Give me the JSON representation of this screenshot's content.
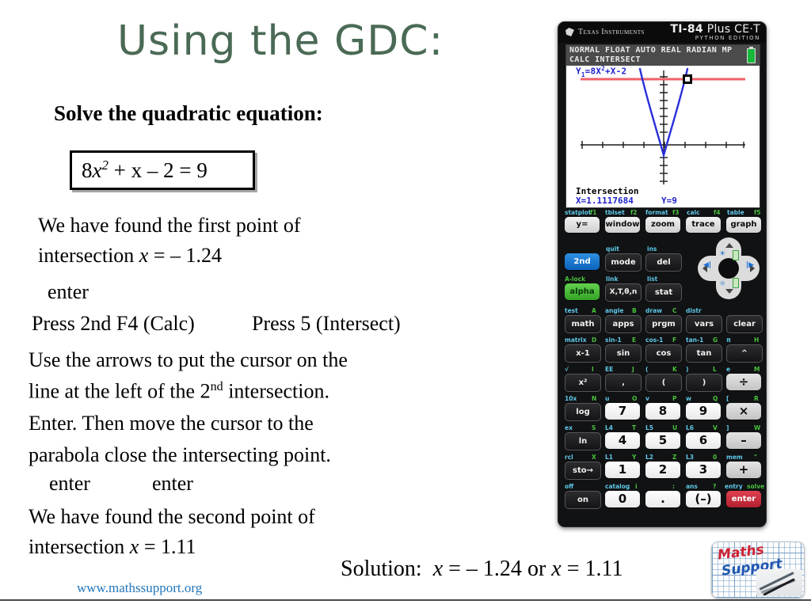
{
  "title": "Using the GDC:",
  "title_color": "#4a6a55",
  "solve_heading": "Solve the quadratic equation:",
  "equation": {
    "coef": "8",
    "var": "x",
    "power": "2",
    "rest": " + x – 2 = 9"
  },
  "body": {
    "found_first_l1": "We have found the first point of",
    "found_first_l2_pre": "intersection ",
    "found_first_l2_var": "x",
    "found_first_l2_post": " = – 1.24",
    "enter_1": "enter",
    "press_calc": "Press 2nd F4 (Calc)",
    "press_intersect": "Press 5 (Intersect)",
    "use_l1": "Use the arrows to put the cursor on the",
    "use_l2_pre": "line at the left of the 2",
    "use_l2_sup": "nd",
    "use_l2_post": "  intersection.",
    "use_l3": "Enter. Then move the cursor to the",
    "use_l4": "parabola close the intersecting point.",
    "enter_2a": "enter",
    "enter_2b": "enter",
    "found_second_l1": "We have found the second point of",
    "found_second_l2_pre": "intersection ",
    "found_second_l2_var": "x",
    "found_second_l2_post": " = 1.11"
  },
  "solution": {
    "label": "Solution:",
    "first_var": "x",
    "first_val": " = – 1.24",
    "conj": "  or  ",
    "second_var": "x",
    "second_val": " = 1.11"
  },
  "footer": {
    "url": "www.mathssupport.org",
    "url_color": "#2277bb"
  },
  "logo": {
    "word_top": "Maths",
    "word_bottom": "Support"
  },
  "calculator": {
    "brand": "Texas Instruments",
    "model_line1_bold": "TI-84",
    "model_line1_rest": " Plus CE·T",
    "model_line2": "PYTHON EDITION",
    "screen": {
      "status_line1": "NORMAL FLOAT AUTO REAL RADIAN MP",
      "status_line2": "CALC INTERSECT",
      "function_prefix": "Y",
      "function_sub": "1",
      "function_body": "=8X",
      "function_sup": "2",
      "function_tail": "+X-2",
      "readout_label": "Intersection",
      "readout_x": "X=1.1117684",
      "readout_y": "Y=9",
      "curve_color": "#2a2fd8",
      "line_color": "#f0606a",
      "battery_color": "#16b83a"
    },
    "keys": {
      "row_f_labels": [
        {
          "name": "statplot",
          "f": "f1"
        },
        {
          "name": "tblset",
          "f": "f2"
        },
        {
          "name": "format",
          "f": "f3"
        },
        {
          "name": "calc",
          "f": "f4"
        },
        {
          "name": "table",
          "f": "f5"
        }
      ],
      "row_f": [
        "y=",
        "window",
        "zoom",
        "trace",
        "graph"
      ],
      "second": "2nd",
      "alpha": "alpha",
      "a_lock": "A-lock",
      "quit": "quit",
      "ins": "ins",
      "mode": "mode",
      "del": "del",
      "link": "link",
      "list": "list",
      "xton": "X,T,θ,n",
      "stat": "stat",
      "labels_math_row": [
        "test",
        "angle",
        "draw",
        "distr"
      ],
      "alphas_math_row": [
        "A",
        "B",
        "C"
      ],
      "math_row": [
        "math",
        "apps",
        "prgm",
        "vars",
        "clear"
      ],
      "labels_trig_row": [
        "matrix",
        "sin-1",
        "cos-1",
        "tan-1",
        "π"
      ],
      "alphas_trig_row": [
        "D",
        "E",
        "F",
        "G",
        "H"
      ],
      "trig_row": [
        "x-1",
        "sin",
        "cos",
        "tan",
        "^"
      ],
      "labels_sq_row": [
        "√",
        "EE",
        "(",
        ")",
        "e"
      ],
      "alphas_sq_row": [
        "I",
        "J",
        "K",
        "L",
        "M"
      ],
      "sq_row": [
        "x²",
        ",",
        "(",
        ")",
        "÷"
      ],
      "labels_log_row": [
        "10x",
        "u",
        "v",
        "w",
        "["
      ],
      "alphas_log_row": [
        "N",
        "O",
        "P",
        "Q",
        "R"
      ],
      "log_row": [
        "log",
        "7",
        "8",
        "9",
        "×"
      ],
      "labels_ln_row": [
        "ex",
        "L4",
        "L5",
        "L6",
        "]"
      ],
      "alphas_ln_row": [
        "S",
        "T",
        "U",
        "V",
        "W"
      ],
      "ln_row": [
        "ln",
        "4",
        "5",
        "6",
        "–"
      ],
      "labels_sto_row": [
        "rcl",
        "L1",
        "L2",
        "L3",
        "mem"
      ],
      "alphas_sto_row": [
        "X",
        "Y",
        "Z",
        "0",
        "\""
      ],
      "sto_row": [
        "sto→",
        "1",
        "2",
        "3",
        "+"
      ],
      "labels_on_row": [
        "off",
        "catalog",
        "i",
        ":",
        "ans",
        "?",
        "entry",
        "solve"
      ],
      "on_row": [
        "on",
        "0",
        ".",
        "(–)",
        "enter"
      ]
    }
  }
}
